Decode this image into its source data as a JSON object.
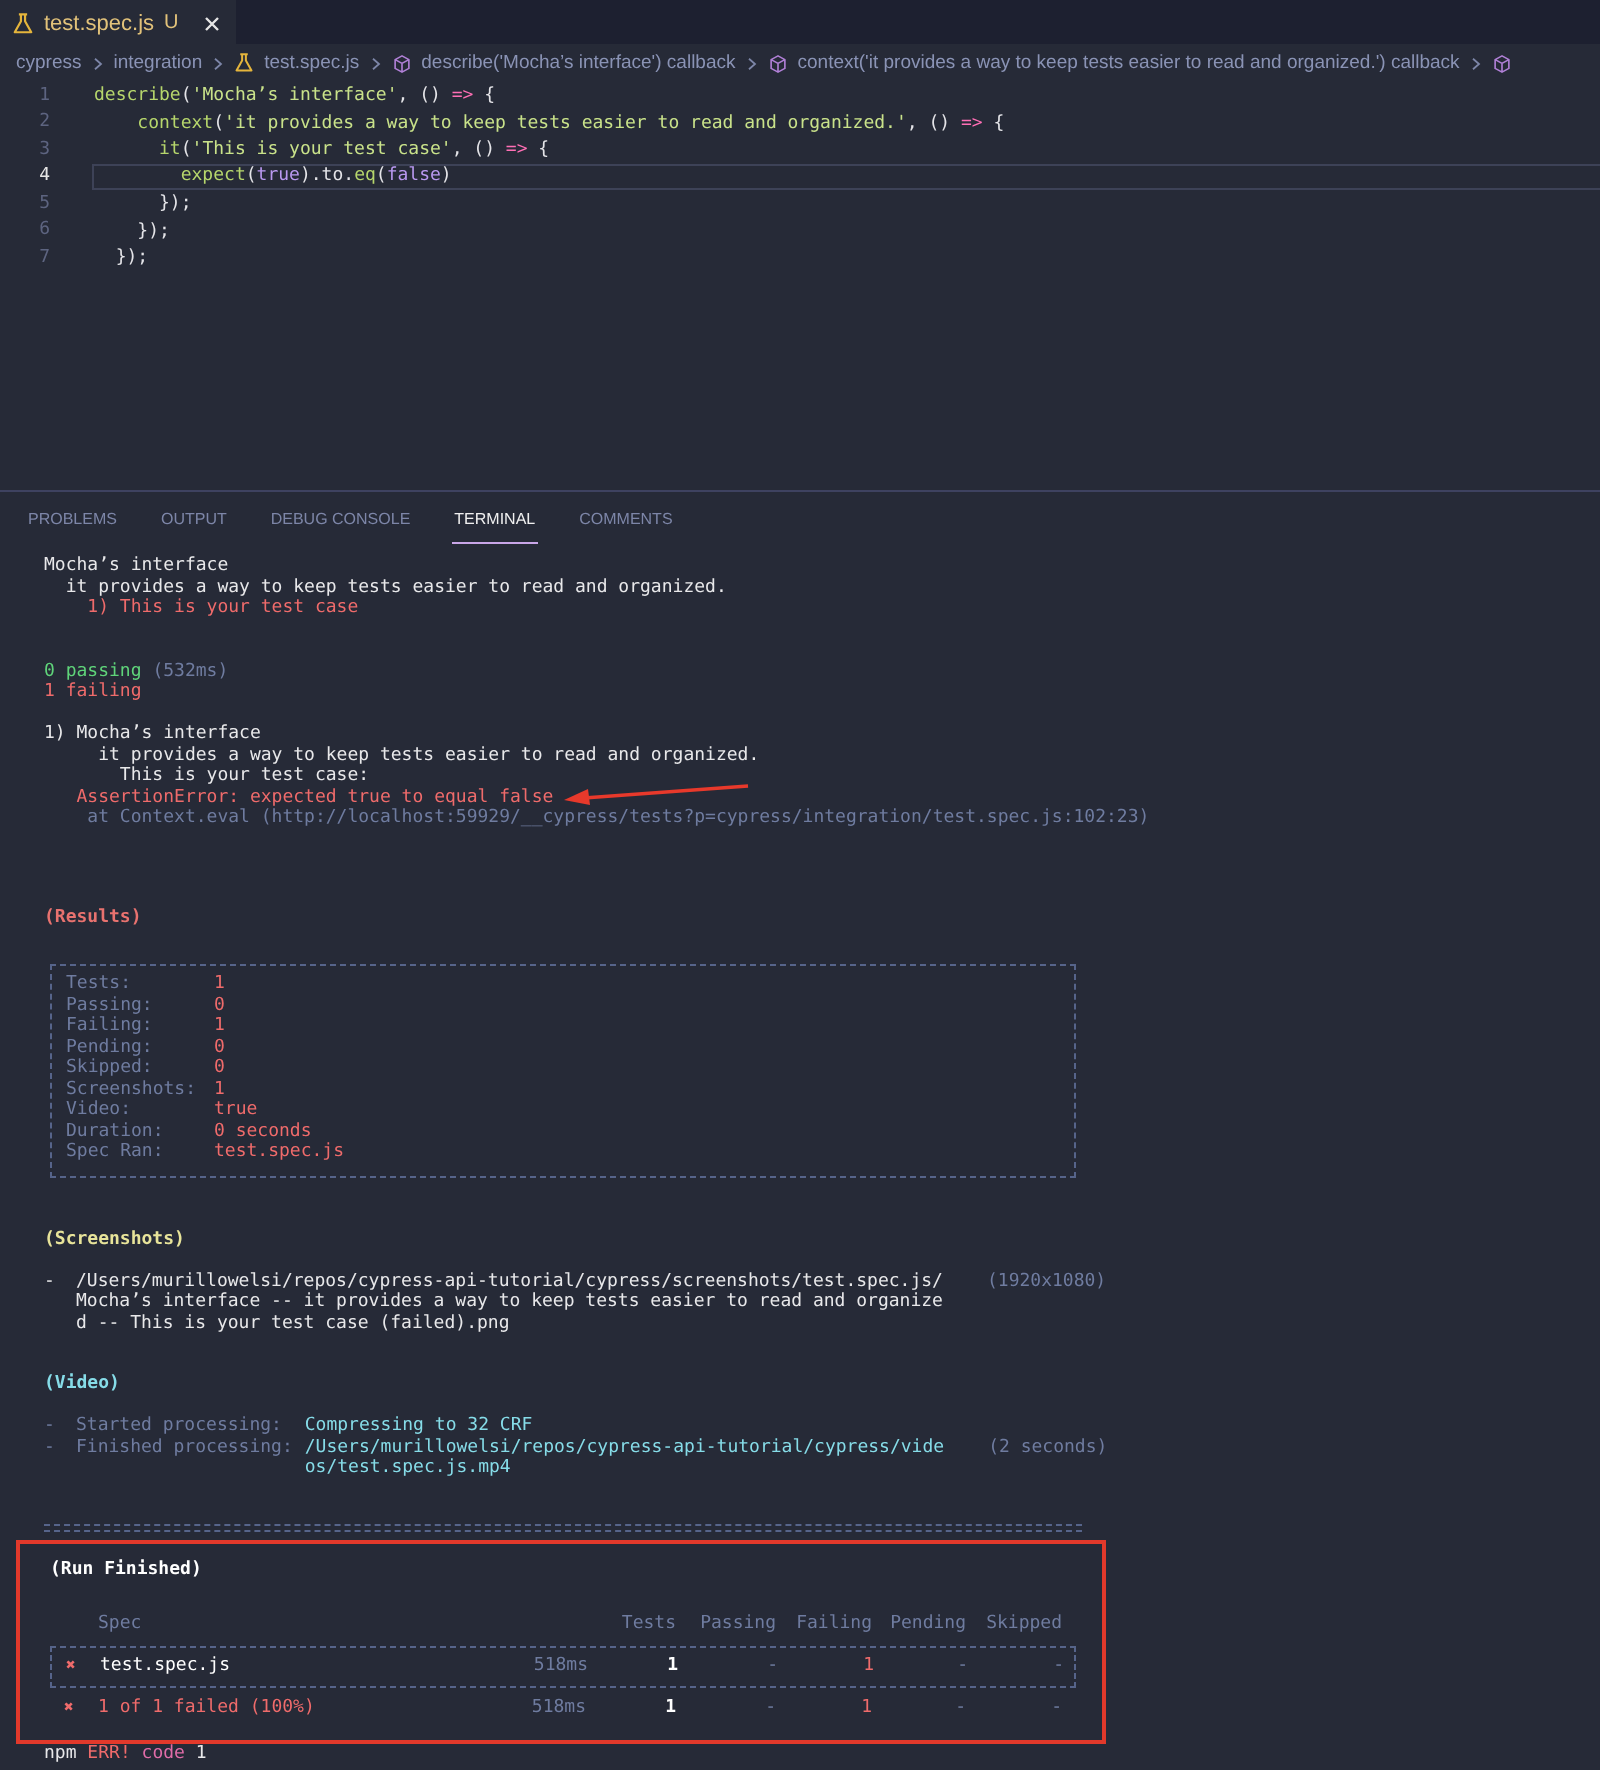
{
  "editor_tab": {
    "label": "test.spec.js",
    "status": "U"
  },
  "breadcrumbs": [
    {
      "kind": "folder",
      "label": "cypress"
    },
    {
      "kind": "folder",
      "label": "integration"
    },
    {
      "kind": "file",
      "label": "test.spec.js"
    },
    {
      "kind": "symbol",
      "label": "describe('Mocha’s interface') callback"
    },
    {
      "kind": "symbol",
      "label": "context('it provides a way to keep tests easier to read and organized.') callback"
    },
    {
      "kind": "symbol"
    }
  ],
  "code": {
    "lines": [
      {
        "number": "1",
        "selected": false,
        "tokens": [
          {
            "kind": "fn",
            "text": "describe"
          },
          {
            "kind": "punc",
            "text": "("
          },
          {
            "kind": "str",
            "text": "'Mocha’s interface'"
          },
          {
            "kind": "punc",
            "text": ", () "
          },
          {
            "kind": "op",
            "text": "=>"
          },
          {
            "kind": "punc",
            "text": " {"
          }
        ]
      },
      {
        "number": "2",
        "selected": false,
        "tokens": [
          {
            "kind": "fn",
            "text": "    context"
          },
          {
            "kind": "punc",
            "text": "("
          },
          {
            "kind": "str",
            "text": "'it provides a way to keep tests easier to read and organized.'"
          },
          {
            "kind": "punc",
            "text": ", () "
          },
          {
            "kind": "op",
            "text": "=>"
          },
          {
            "kind": "punc",
            "text": " {"
          }
        ]
      },
      {
        "number": "3",
        "selected": false,
        "tokens": [
          {
            "kind": "fn",
            "text": "      it"
          },
          {
            "kind": "punc",
            "text": "("
          },
          {
            "kind": "str",
            "text": "'This is your test case'"
          },
          {
            "kind": "punc",
            "text": ", () "
          },
          {
            "kind": "op",
            "text": "=>"
          },
          {
            "kind": "punc",
            "text": " {"
          }
        ]
      },
      {
        "number": "4",
        "selected": true,
        "tokens": [
          {
            "kind": "fn",
            "text": "        expect"
          },
          {
            "kind": "punc",
            "text": "("
          },
          {
            "kind": "bool",
            "text": "true"
          },
          {
            "kind": "punc",
            "text": ").to."
          },
          {
            "kind": "fn",
            "text": "eq"
          },
          {
            "kind": "punc",
            "text": "("
          },
          {
            "kind": "bool",
            "text": "false"
          },
          {
            "kind": "punc",
            "text": ")"
          }
        ]
      },
      {
        "number": "5",
        "selected": false,
        "tokens": [
          {
            "kind": "punc",
            "text": "      });"
          }
        ]
      },
      {
        "number": "6",
        "selected": false,
        "tokens": [
          {
            "kind": "punc",
            "text": "    });"
          }
        ]
      },
      {
        "number": "7",
        "selected": false,
        "tokens": [
          {
            "kind": "punc",
            "text": "  });"
          }
        ]
      }
    ]
  },
  "panel_tabs": [
    {
      "label": "PROBLEMS",
      "selected": false
    },
    {
      "label": "OUTPUT",
      "selected": false
    },
    {
      "label": "DEBUG CONSOLE",
      "selected": false
    },
    {
      "label": "TERMINAL",
      "selected": true
    },
    {
      "label": "COMMENTS",
      "selected": false
    }
  ],
  "output": [
    {
      "kind": "tree",
      "lines": [
        [
          {
            "kind": "plain",
            "text": "Mocha’s interface"
          }
        ],
        [
          {
            "kind": "plain",
            "text": "  it provides a way to keep tests easier to read and organized."
          }
        ],
        [
          {
            "kind": "fail",
            "text": "    1) This is your test case"
          }
        ]
      ]
    },
    {
      "kind": "stats",
      "lines": [
        [
          {
            "kind": "pass",
            "text": "0 passing"
          },
          {
            "kind": "muted",
            "text": " (532ms)"
          }
        ],
        [
          {
            "kind": "fail",
            "text": "1 failing"
          }
        ]
      ]
    },
    {
      "kind": "failure",
      "lines": [
        [
          {
            "kind": "plain",
            "text": "1) Mocha’s interface"
          }
        ],
        [
          {
            "kind": "plain",
            "text": "     it provides a way to keep tests easier to read and organized."
          }
        ],
        [
          {
            "kind": "plain",
            "text": "       This is your test case:"
          }
        ],
        [
          {
            "kind": "fail",
            "text": "   AssertionError: expected true to equal false"
          }
        ],
        [
          {
            "kind": "muted",
            "text": "    at Context.eval (http://localhost:59929/__cypress/tests?p=cypress/integration/test.spec.js:102:23)"
          }
        ]
      ]
    },
    {
      "kind": "results",
      "title": "(Results)",
      "color": "#e8726f",
      "rows": [
        {
          "label": "Tests:",
          "value": "1"
        },
        {
          "label": "Passing:",
          "value": "0"
        },
        {
          "label": "Failing:",
          "value": "1"
        },
        {
          "label": "Pending:",
          "value": "0"
        },
        {
          "label": "Skipped:",
          "value": "0"
        },
        {
          "label": "Screenshots:",
          "value": "1"
        },
        {
          "label": "Video:",
          "value": "true"
        },
        {
          "label": "Duration:",
          "value": "0 seconds"
        },
        {
          "label": "Spec Ran:",
          "value": "test.spec.js"
        }
      ]
    },
    {
      "kind": "screenshots",
      "title": "(Screenshots)",
      "color": "#e8e49a",
      "items": [
        {
          "marker": "-",
          "lines": [
            "/Users/murillowelsi/repos/cypress-api-tutorial/cypress/screenshots/test.spec.js/",
            "Mocha’s interface -- it provides a way to keep tests easier to read and organize",
            "d -- This is your test case (failed).png"
          ],
          "note": "(1920x1080)"
        }
      ]
    },
    {
      "kind": "video",
      "title": "(Video)",
      "color": "#86dce8",
      "items": [
        {
          "marker": "-",
          "label": "Started processing:",
          "lines": [
            "Compressing to 32 CRF"
          ]
        },
        {
          "marker": "-",
          "label": "Finished processing:",
          "lines": [
            "/Users/murillowelsi/repos/cypress-api-tutorial/cypress/vide",
            "os/test.spec.js.mp4"
          ],
          "note": "(2 seconds)"
        }
      ]
    },
    {
      "kind": "run_finished",
      "title": "(Run Finished)",
      "color": "#ffffff",
      "columns": [
        "Spec",
        "Tests",
        "Passing",
        "Failing",
        "Pending",
        "Skipped"
      ],
      "rows": [
        {
          "kind": "spec",
          "status": "✖",
          "spec": "test.spec.js",
          "duration": "518ms",
          "tests": "1",
          "passing": "-",
          "failing": "1",
          "pending": "-",
          "skipped": "-"
        },
        {
          "kind": "total",
          "status": "✖",
          "spec": "1 of 1 failed (100%)",
          "duration": "518ms",
          "tests": "1",
          "passing": "-",
          "failing": "1",
          "pending": "-",
          "skipped": "-"
        }
      ]
    },
    {
      "kind": "npm",
      "lines": [
        [
          {
            "kind": "plain",
            "text": "npm"
          },
          {
            "kind": "fail",
            "text": " ERR!"
          },
          {
            "kind": "keyword",
            "text": " code"
          },
          {
            "kind": "plain",
            "text": " 1"
          }
        ]
      ]
    }
  ]
}
